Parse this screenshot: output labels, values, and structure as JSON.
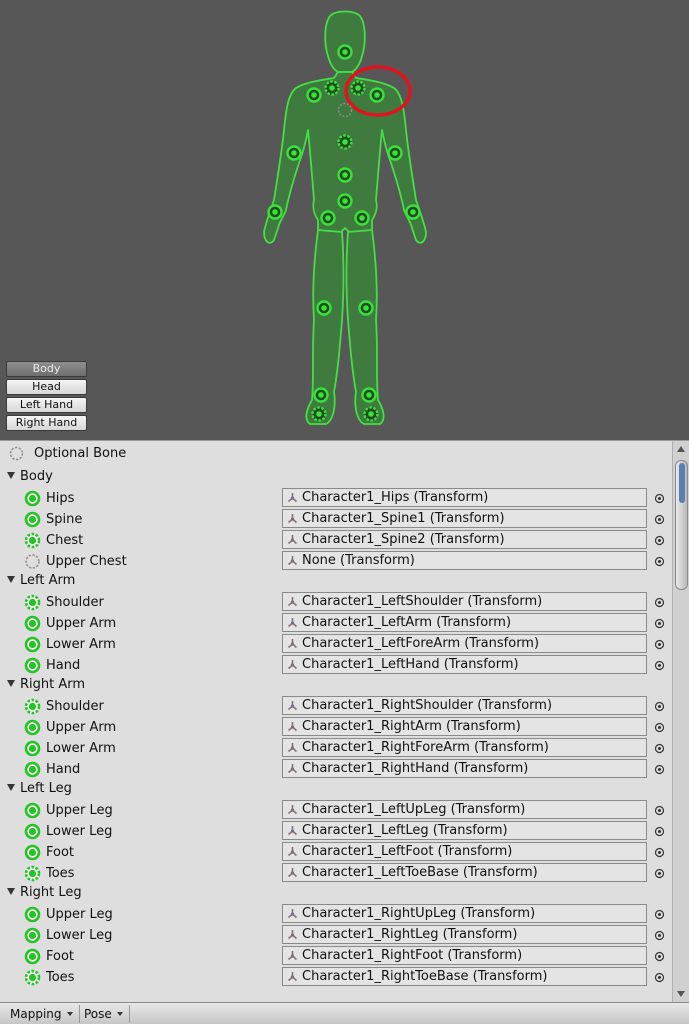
{
  "view_buttons": [
    "Body",
    "Head",
    "Left Hand",
    "Right Hand"
  ],
  "active_view": "Body",
  "colors": {
    "bone_green": "#3be03b",
    "highlight_red": "#e0141e",
    "preview_bg": "#575757"
  },
  "legend": {
    "label": "Optional Bone",
    "icon": "dashed-circle-icon"
  },
  "groups": [
    {
      "name": "Body",
      "bones": [
        {
          "label": "Hips",
          "value": "Character1_Hips (Transform)",
          "type": "required"
        },
        {
          "label": "Spine",
          "value": "Character1_Spine1 (Transform)",
          "type": "required"
        },
        {
          "label": "Chest",
          "value": "Character1_Spine2 (Transform)",
          "type": "optional-mapped"
        },
        {
          "label": "Upper Chest",
          "value": "None (Transform)",
          "type": "optional-empty"
        }
      ]
    },
    {
      "name": "Left Arm",
      "bones": [
        {
          "label": "Shoulder",
          "value": "Character1_LeftShoulder (Transform)",
          "type": "optional-mapped"
        },
        {
          "label": "Upper Arm",
          "value": "Character1_LeftArm (Transform)",
          "type": "required"
        },
        {
          "label": "Lower Arm",
          "value": "Character1_LeftForeArm (Transform)",
          "type": "required"
        },
        {
          "label": "Hand",
          "value": "Character1_LeftHand (Transform)",
          "type": "required"
        }
      ]
    },
    {
      "name": "Right Arm",
      "bones": [
        {
          "label": "Shoulder",
          "value": "Character1_RightShoulder (Transform)",
          "type": "optional-mapped"
        },
        {
          "label": "Upper Arm",
          "value": "Character1_RightArm (Transform)",
          "type": "required"
        },
        {
          "label": "Lower Arm",
          "value": "Character1_RightForeArm (Transform)",
          "type": "required"
        },
        {
          "label": "Hand",
          "value": "Character1_RightHand (Transform)",
          "type": "required"
        }
      ]
    },
    {
      "name": "Left Leg",
      "bones": [
        {
          "label": "Upper Leg",
          "value": "Character1_LeftUpLeg (Transform)",
          "type": "required"
        },
        {
          "label": "Lower Leg",
          "value": "Character1_LeftLeg (Transform)",
          "type": "required"
        },
        {
          "label": "Foot",
          "value": "Character1_LeftFoot (Transform)",
          "type": "required"
        },
        {
          "label": "Toes",
          "value": "Character1_LeftToeBase (Transform)",
          "type": "optional-mapped"
        }
      ]
    },
    {
      "name": "Right Leg",
      "bones": [
        {
          "label": "Upper Leg",
          "value": "Character1_RightUpLeg (Transform)",
          "type": "required"
        },
        {
          "label": "Lower Leg",
          "value": "Character1_RightLeg (Transform)",
          "type": "required"
        },
        {
          "label": "Foot",
          "value": "Character1_RightFoot (Transform)",
          "type": "required"
        },
        {
          "label": "Toes",
          "value": "Character1_RightToeBase (Transform)",
          "type": "optional-mapped"
        }
      ]
    }
  ],
  "toolbar": {
    "mapping_label": "Mapping",
    "pose_label": "Pose"
  }
}
